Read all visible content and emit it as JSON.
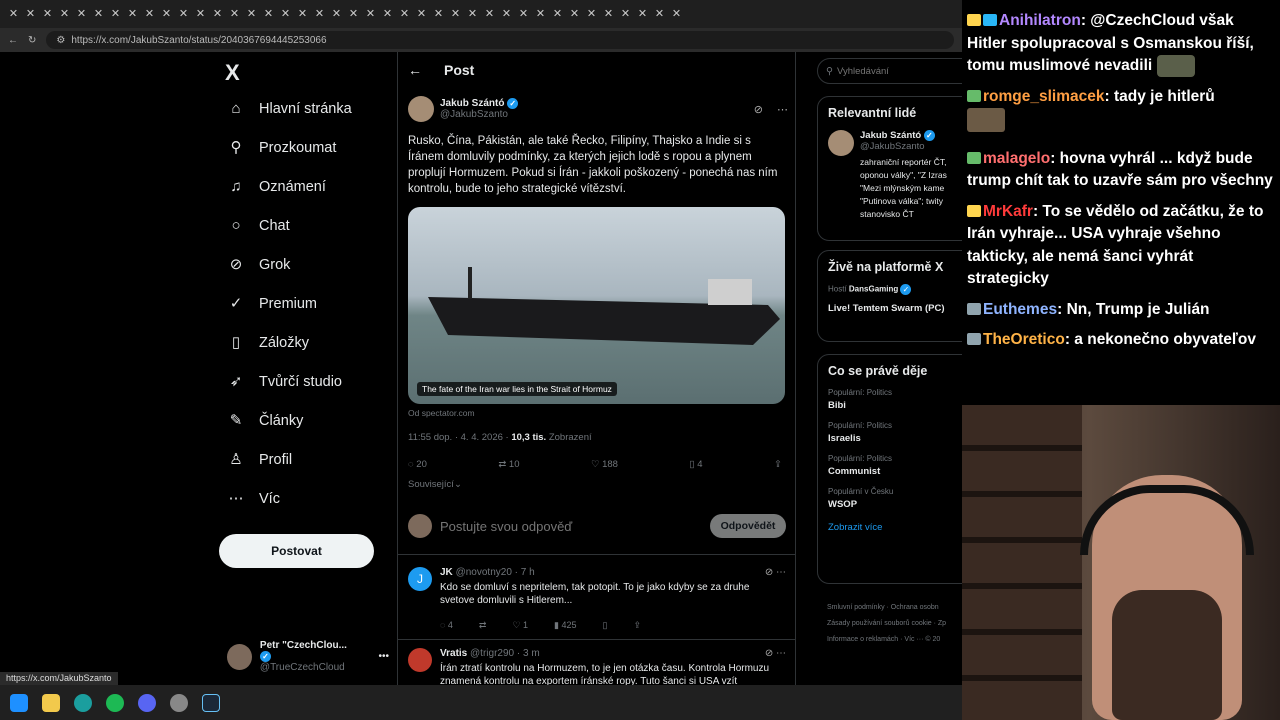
{
  "browser": {
    "url": "https://x.com/JakubSzanto/status/2040367694445253066",
    "status_url": "https://x.com/JakubSzanto"
  },
  "nav": {
    "logo": "X",
    "items": [
      {
        "label": "Hlavní stránka",
        "icon": "home-icon"
      },
      {
        "label": "Prozkoumat",
        "icon": "search-icon"
      },
      {
        "label": "Oznámení",
        "icon": "bell-icon"
      },
      {
        "label": "Chat",
        "icon": "chat-icon"
      },
      {
        "label": "Grok",
        "icon": "grok-icon"
      },
      {
        "label": "Premium",
        "icon": "premium-icon"
      },
      {
        "label": "Záložky",
        "icon": "bookmark-icon"
      },
      {
        "label": "Tvůrčí studio",
        "icon": "rocket-icon"
      },
      {
        "label": "Články",
        "icon": "article-icon"
      },
      {
        "label": "Profil",
        "icon": "profile-icon"
      },
      {
        "label": "Víc",
        "icon": "more-icon"
      }
    ],
    "post_button": "Postovat",
    "account_name": "Petr \"CzechClou...",
    "account_handle": "@TrueCzechCloud"
  },
  "main": {
    "header": "Post",
    "tweet": {
      "author": "Jakub Szántó",
      "handle": "@JakubSzanto",
      "text": "Rusko, Čína, Pákistán, ale také Řecko, Filipíny, Thajsko a Indie si s Íránem domluvily podmínky, za kterých jejich lodě s ropou a plynem proplují Hormuzem. Pokud si Írán - jakkoli poškozený - ponechá nas ním kontrolu, bude to jeho strategické vítězství.",
      "card_caption": "The fate of the Iran war lies in the Strait of Hormuz",
      "card_source": "Od spectator.com",
      "time": "11:55 dop. · 4. 4. 2026 ·",
      "views": "10,3 tis.",
      "views_label": "Zobrazení",
      "replies": "20",
      "reposts": "10",
      "likes": "188",
      "bookmarks": "4",
      "related": "Související"
    },
    "reply_placeholder": "Postujte svou odpověď",
    "reply_button": "Odpovědět",
    "replies": [
      {
        "author": "JK",
        "handle": "@novotny20 · 7 h",
        "text": "Kdo se domluví s nepritelem, tak potopit.  To je jako kdyby se za druhe svetove domluvili s Hitlerem...",
        "replies": "4",
        "likes": "1",
        "views": "425"
      },
      {
        "author": "Vratis",
        "handle": "@trigr290 · 3 m",
        "text": "Írán ztratí kontrolu na Hormuzem, to je jen otázka času. Kontrola Hormuzu znamená kontrolu na exportem íránské ropy. Tuto šanci si USA vzít"
      }
    ]
  },
  "right": {
    "search_placeholder": "Vyhledávání",
    "relevant_title": "Relevantní lidé",
    "relevant_name": "Jakub Szántó",
    "relevant_handle": "@JakubSzanto",
    "relevant_bio": "zahraniční reportér ČT, oponou války\", \"Z Izras \"Mezi mlýnským kame \"Putinova válka\"; twity stanovisko ČT",
    "live_title": "Živě na platformě X",
    "live_host_label": "Hostí",
    "live_host": "DansGaming",
    "live_stream": "Live! Temtem Swarm (PC)",
    "happening_title": "Co se právě děje",
    "trends": [
      {
        "kind": "Populární: Politics",
        "name": "Bibi"
      },
      {
        "kind": "Populární: Politics",
        "name": "Israelis"
      },
      {
        "kind": "Populární: Politics",
        "name": "Communist"
      },
      {
        "kind": "Populární v Česku",
        "name": "WSOP"
      }
    ],
    "show_more": "Zobrazit více",
    "footer1": "Smluvní podmínky · Ochrana osobn",
    "footer2": "Zásady používání souborů cookie · Zp",
    "footer3": "Informace o reklamách · Víc ··· © 20"
  },
  "chat": {
    "messages": [
      {
        "user": "Anihilatron",
        "color": "#b388ff",
        "text": "@CzechCloud však Hitler spolupracoval s Osmanskou říší, tomu muslimové nevadili"
      },
      {
        "user": "romge_slimacek",
        "color": "#ff9f43",
        "text": "tady je hitlerů"
      },
      {
        "user": "malagelo",
        "color": "#ff6f6f",
        "text": "hovna vyhrál ... když bude trump chít tak to uzavře sám pro všechny"
      },
      {
        "user": "MrKafr",
        "color": "#ff3b3b",
        "text": "To se vědělo od začátku, že to Irán vyhraje... USA vyhraje všehno takticky, ale nemá šanci vyhrát strategicky"
      },
      {
        "user": "Euthemes",
        "color": "#8fb4ff",
        "text": "Nn, Trump je Julián"
      },
      {
        "user": "TheOretico",
        "color": "#ffb347",
        "text": "a nekonečno obyvateľov"
      }
    ]
  }
}
